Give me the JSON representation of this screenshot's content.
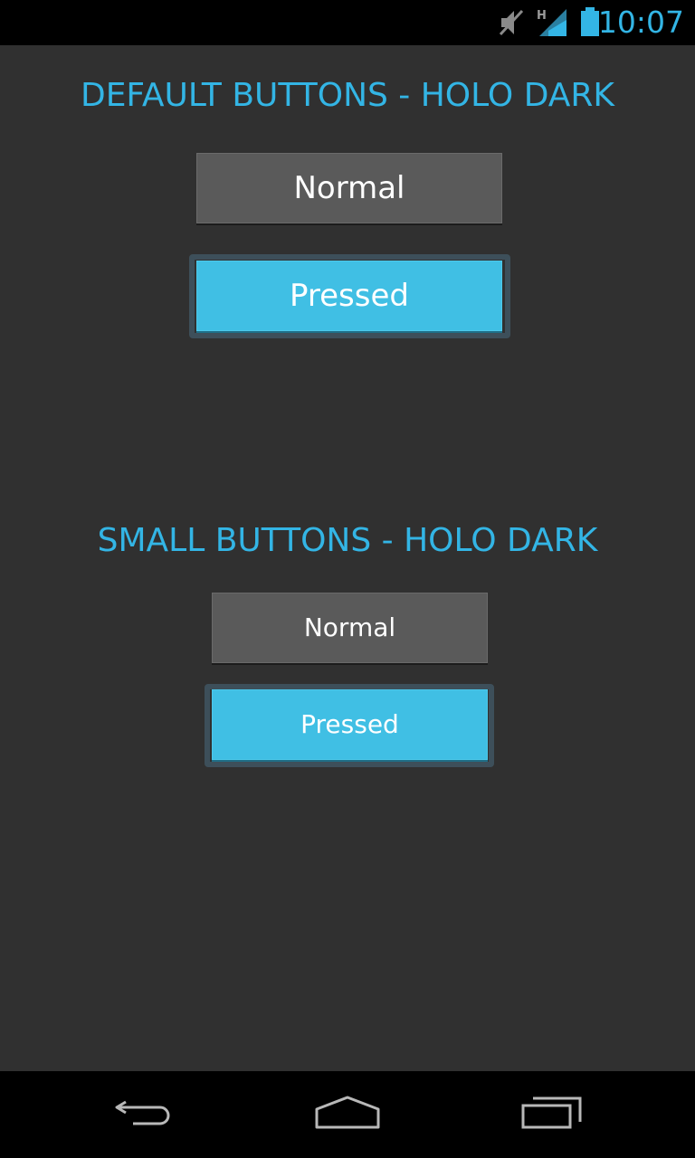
{
  "status_bar": {
    "time": "10:07",
    "network_type": "H",
    "icons": [
      "mute-icon",
      "signal-icon",
      "battery-icon"
    ],
    "accent_color": "#33b5e5"
  },
  "sections": [
    {
      "title": "DEFAULT BUTTONS - HOLO DARK",
      "normal_label": "Normal",
      "pressed_label": "Pressed"
    },
    {
      "title": "SMALL BUTTONS - HOLO DARK",
      "normal_label": "Normal",
      "pressed_label": "Pressed"
    }
  ],
  "nav_bar": {
    "icons": [
      "back-icon",
      "home-icon",
      "recent-apps-icon"
    ]
  },
  "colors": {
    "background": "#303030",
    "accent": "#33b5e5",
    "button_normal": "#5a5a5a",
    "button_pressed": "#40bfe4"
  }
}
